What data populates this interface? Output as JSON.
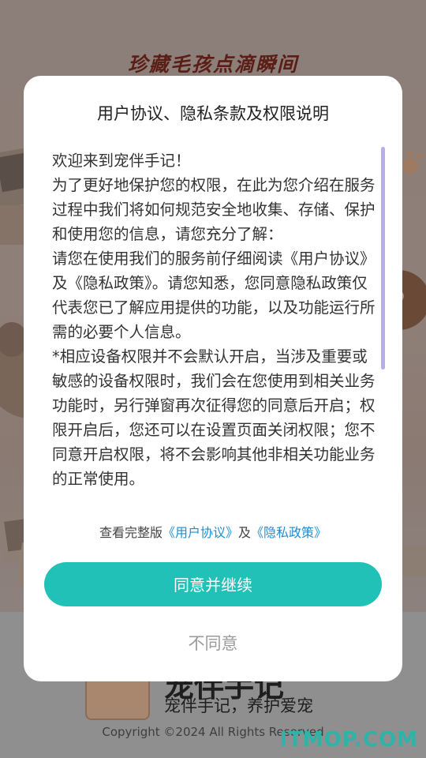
{
  "background": {
    "banner_text": "珍藏毛孩点滴瞬间",
    "app_name": "宠伴手记",
    "slogan": "宠伴手记，养护爱宠",
    "copyright": "Copyright ©2024 All Rights Reserved",
    "watermark": "ITMOP.COM"
  },
  "dialog": {
    "title": "用户协议、隐私条款及权限说明",
    "paragraphs": [
      "欢迎来到宠伴手记！",
      "为了更好地保护您的权限，在此为您介绍在服务过程中我们将如何规范安全地收集、存储、保护和使用您的信息，请您充分了解：",
      "请您在使用我们的服务前仔细阅读《用户协议》及《隐私政策》。请您知悉，您同意隐私政策仅代表您已了解应用提供的功能，以及功能运行所需的必要个人信息。",
      "*相应设备权限并不会默认开启，当涉及重要或敏感的设备权限时，我们会在您使用到相关业务功能时，另行弹窗再次征得您的同意后开启；权限开启后，您还可以在设置页面关闭权限；您不同意开启权限，将不会影响其他非相关功能业务的正常使用。"
    ],
    "links_prefix": "查看完整版",
    "user_agreement_link": "《用户协议》",
    "links_and": "及",
    "privacy_policy_link": "《隐私政策》",
    "agree_button": "同意并继续",
    "disagree_button": "不同意",
    "scroll_position": 0
  },
  "colors": {
    "accent": "#21c1b8",
    "link": "#1f8ecf",
    "scrollbar": "#b8aee6"
  }
}
